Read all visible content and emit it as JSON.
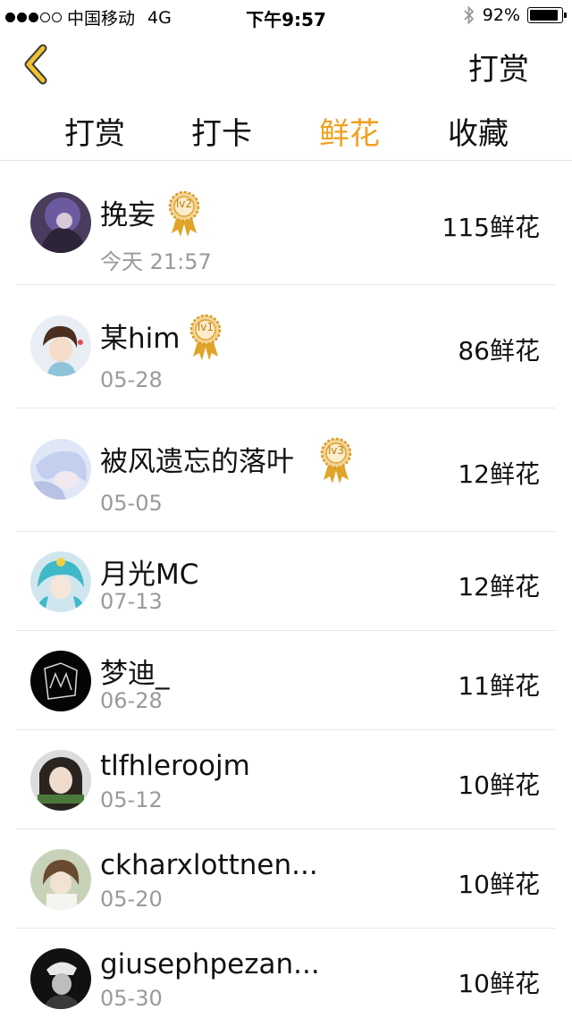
{
  "status_bar": {
    "carrier": "中国移动",
    "network": "4G",
    "time": "下午9:57",
    "battery": "92%",
    "battery_level": 0.92
  },
  "nav": {
    "action_label": "打赏"
  },
  "tabs": [
    {
      "label": "打赏",
      "active": false
    },
    {
      "label": "打卡",
      "active": false
    },
    {
      "label": "鲜花",
      "active": true
    },
    {
      "label": "收藏",
      "active": false
    }
  ],
  "colors": {
    "accent": "#f0a020",
    "text": "#111111",
    "secondary_text": "#9a9a9a",
    "divider": "#e8e8e8"
  },
  "list": [
    {
      "name": "挽妄",
      "badge": "lv2",
      "date": "今天 21:57",
      "count": "115鲜花"
    },
    {
      "name": "某him",
      "badge": "lv1",
      "date": "05-28",
      "count": "86鲜花"
    },
    {
      "name": "被风遗忘的落叶",
      "badge": "lv3",
      "date": "05-05",
      "count": "12鲜花"
    },
    {
      "name": "月光MC",
      "badge": "",
      "date": "07-13",
      "count": "12鲜花"
    },
    {
      "name": "梦迪_",
      "badge": "",
      "date": "06-28",
      "count": "11鲜花"
    },
    {
      "name": "tlfhleroojm",
      "badge": "",
      "date": "05-12",
      "count": "10鲜花"
    },
    {
      "name": "ckharxlottnen...",
      "badge": "",
      "date": "05-20",
      "count": "10鲜花"
    },
    {
      "name": "giusephpezan...",
      "badge": "",
      "date": "05-30",
      "count": "10鲜花"
    }
  ]
}
